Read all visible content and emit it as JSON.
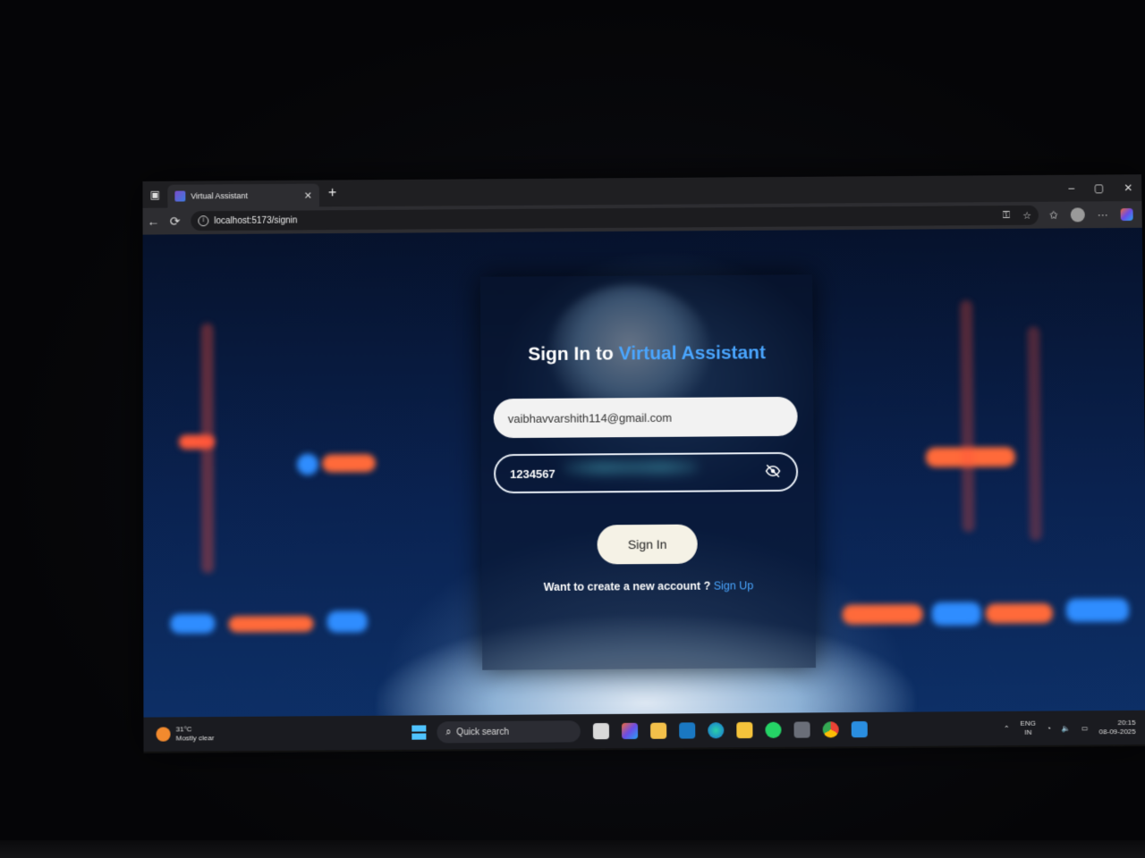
{
  "browser": {
    "tab_title": "Virtual Assistant",
    "tab_close": "✕",
    "new_tab": "+",
    "url": "localhost:5173/signin",
    "window_controls": [
      "–",
      "▢",
      "✕"
    ],
    "nav": {
      "back": "←",
      "reload": "⟳"
    },
    "toolbar_icons": [
      "key-icon",
      "star-icon",
      "favorites-icon",
      "profile-avatar",
      "more-icon",
      "copilot-icon"
    ],
    "more_label": "···"
  },
  "signin": {
    "title_prefix": "Sign In to ",
    "title_accent": "Virtual Assistant",
    "email_value": "vaibhavvarshith114@gmail.com",
    "password_value": "1234567",
    "button_label": "Sign In",
    "signup_prompt": "Want to create a new account ? ",
    "signup_link": "Sign Up"
  },
  "taskbar": {
    "weather_temp": "31°C",
    "weather_desc": "Mostly clear",
    "search_label": "Quick search",
    "language_top": "ENG",
    "language_bottom": "IN",
    "time": "20:15",
    "date": "08-09-2025",
    "colors": {
      "accent": "#4aa6ff",
      "taskbar": "#1a1b20"
    }
  }
}
